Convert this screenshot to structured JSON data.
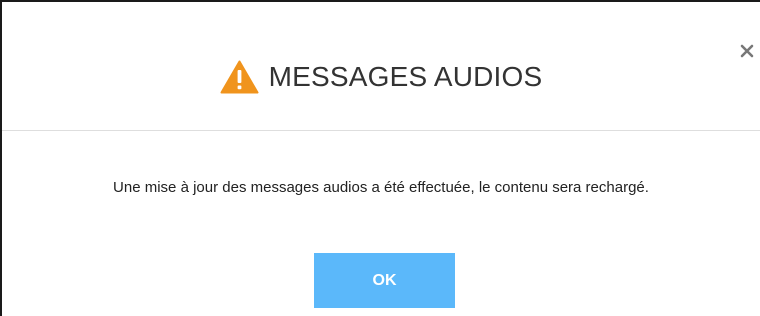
{
  "dialog": {
    "title": "MESSAGES AUDIOS",
    "title_icon": "warning-triangle-icon",
    "close_icon": "close-icon",
    "close_symbol": "×",
    "message": "Une mise à jour des messages audios a été effectuée, le contenu sera rechargé.",
    "ok_label": "OK"
  },
  "colors": {
    "warning_icon": "#f0941d",
    "ok_button": "#5bb8fa",
    "title_text": "#333333",
    "close_icon": "#777777"
  }
}
